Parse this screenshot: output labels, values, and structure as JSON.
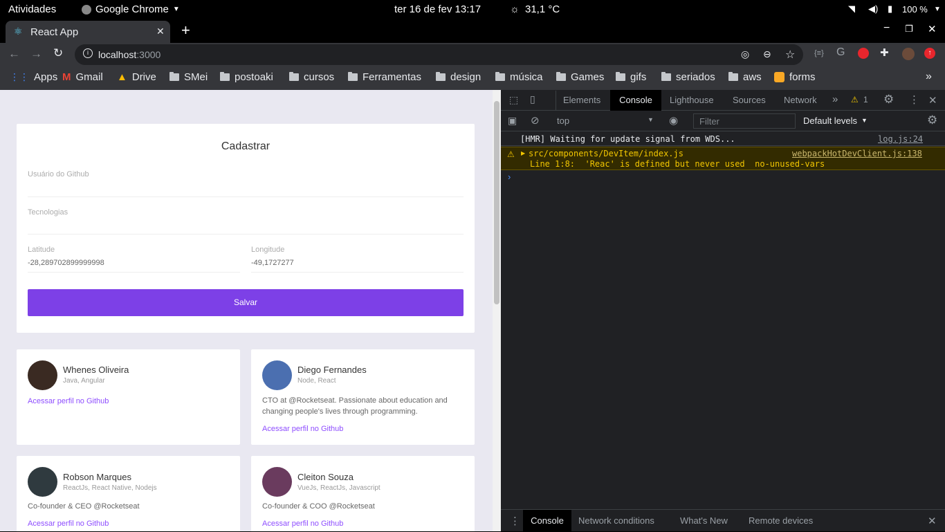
{
  "system": {
    "activities": "Atividades",
    "app": "Google Chrome",
    "datetime": "ter 16 de fev  13:17",
    "weather": "31,1 °C",
    "battery": "100 %"
  },
  "browser": {
    "tab_title": "React App",
    "url_host": "localhost",
    "url_port": ":3000",
    "bookmarks": [
      "Apps",
      "Gmail",
      "Drive",
      "SMei",
      "postoaki",
      "cursos",
      "Ferramentas",
      "design",
      "música",
      "Games",
      "gifs",
      "seriados",
      "aws",
      "forms"
    ]
  },
  "form": {
    "title": "Cadastrar",
    "github_label": "Usuário do Github",
    "github_value": "",
    "techs_label": "Tecnologias",
    "techs_value": "",
    "lat_label": "Latitude",
    "lat_value": "-28,289702899999998",
    "lon_label": "Longitude",
    "lon_value": "-49,1727277",
    "submit": "Salvar"
  },
  "devs": [
    {
      "name": "Whenes Oliveira",
      "techs": "Java, Angular",
      "bio": "",
      "link": "Acessar perfil no Github"
    },
    {
      "name": "Diego Fernandes",
      "techs": "Node, React",
      "bio": "CTO at @Rocketseat. Passionate about education and changing people's lives through programming.",
      "link": "Acessar perfil no Github"
    },
    {
      "name": "Robson Marques",
      "techs": "ReactJs, React Native, Nodejs",
      "bio": "Co-founder & CEO @Rocketseat",
      "link": "Acessar perfil no Github"
    },
    {
      "name": "Cleiton Souza",
      "techs": "VueJs, ReactJs, Javascript",
      "bio": "Co-founder & COO @Rocketseat",
      "link": "Acessar perfil no Github"
    }
  ],
  "devtools": {
    "tabs": [
      "Elements",
      "Console",
      "Lighthouse",
      "Sources",
      "Network"
    ],
    "active_tab": "Console",
    "warn_count": "1",
    "context": "top",
    "filter_placeholder": "Filter",
    "levels": "Default levels",
    "log1": "[HMR] Waiting for update signal from WDS...",
    "log1_src": "log.js:24",
    "warn_file": "src/components/DevItem/index.js",
    "warn_src": "webpackHotDevClient.js:138",
    "warn_msg": "Line 1:8:  'Reac' is defined but never used  no-unused-vars",
    "drawer_tabs": [
      "Console",
      "Network conditions",
      "What's New",
      "Remote devices"
    ]
  },
  "colors": {
    "accent": "#7d40e7",
    "devtools_bg": "#202124",
    "warning_bg": "#332b00"
  }
}
